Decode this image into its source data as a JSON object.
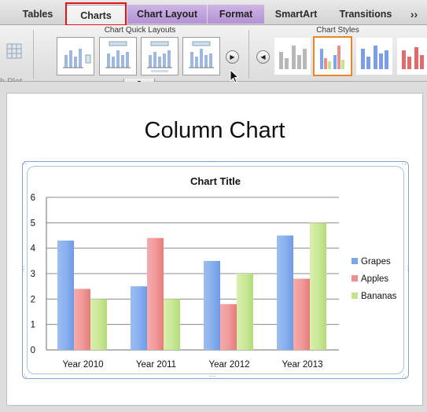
{
  "ribbon": {
    "tabs": [
      {
        "label": "Tables"
      },
      {
        "label": "Charts"
      },
      {
        "label": "Chart Layout"
      },
      {
        "label": "Format"
      },
      {
        "label": "SmartArt"
      },
      {
        "label": "Transitions"
      }
    ],
    "overflow_symbol": "››",
    "groups": {
      "plot_label": "h Plot",
      "quick_layouts_title": "Chart Quick Layouts",
      "styles_title": "Chart Styles"
    },
    "colors": {
      "selected_tab_outline": "#e2141a",
      "selected_style_outline": "#e8872a",
      "chart_layout_tab": "#c4a6de"
    }
  },
  "slide": {
    "title": "Column Chart"
  },
  "chart_data": {
    "type": "bar",
    "title": "Chart Title",
    "categories": [
      "Year 2010",
      "Year 2011",
      "Year 2012",
      "Year 2013"
    ],
    "series": [
      {
        "name": "Grapes",
        "values": [
          4.3,
          2.5,
          3.5,
          4.5
        ],
        "color": "#7aa6ec"
      },
      {
        "name": "Apples",
        "values": [
          2.4,
          4.4,
          1.8,
          2.8
        ],
        "color": "#ef8d8d"
      },
      {
        "name": "Bananas",
        "values": [
          2.0,
          2.0,
          3.0,
          5.0
        ],
        "color": "#c3e38d"
      }
    ],
    "y_ticks": [
      "0",
      "1",
      "2",
      "3",
      "4",
      "5",
      "6"
    ],
    "ylim": [
      0,
      6
    ],
    "xlabel": "",
    "ylabel": "",
    "grid": true,
    "legend_position": "right"
  }
}
